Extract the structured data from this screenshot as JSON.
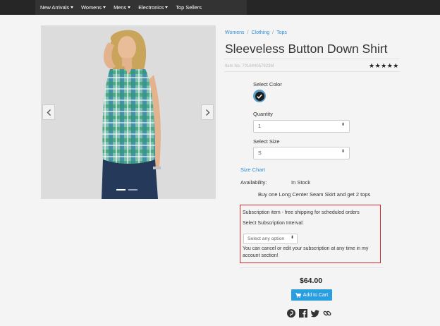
{
  "nav": {
    "items": [
      {
        "label": "New Arrivals",
        "dropdown": true
      },
      {
        "label": "Womens",
        "dropdown": true
      },
      {
        "label": "Mens",
        "dropdown": true
      },
      {
        "label": "Electronics",
        "dropdown": true
      },
      {
        "label": "Top Sellers",
        "dropdown": false
      }
    ]
  },
  "carousel": {
    "slide_count": 2,
    "active_index": 0
  },
  "breadcrumb": {
    "items": [
      "Womens",
      "Clothing",
      "Tops"
    ],
    "separator": "/"
  },
  "product": {
    "title": "Sleeveless Button Down Shirt",
    "item_no": "Item No. 701644057923M",
    "rating": 5,
    "stars": "★★★★★"
  },
  "options": {
    "color_label": "Select Color",
    "quantity_label": "Quantity",
    "quantity_value": "1",
    "size_label": "Select Size",
    "size_value": "S",
    "select_arrow": "⬍"
  },
  "info": {
    "size_chart": "Size Chart",
    "availability_label": "Availability:",
    "availability_value": "In Stock",
    "promo": "Buy one Long Center Seam Skirt and get 2 tops"
  },
  "subscription": {
    "title": "Subscription item - free shipping for scheduled orders",
    "interval_label": "Select Subscription Interval:",
    "placeholder": "Select any option",
    "note": "You can cancel or edit your subscription at any time in my account section!"
  },
  "purchase": {
    "price": "$64.00",
    "add_to_cart": "Add to Cart"
  },
  "social": [
    "pinterest-icon",
    "facebook-icon",
    "twitter-icon",
    "link-icon"
  ],
  "colors": {
    "nav_bg": "#333333",
    "link": "#2f8fd8",
    "cart_button": "#2a9fe0",
    "highlight_border": "#d62b2b"
  }
}
